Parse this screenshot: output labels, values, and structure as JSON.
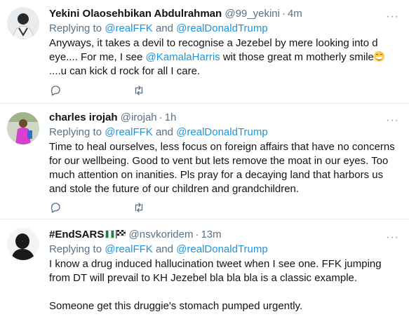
{
  "tweets": [
    {
      "name": "Yekini Olaosehbikan Abdulrahman",
      "handle": "@99_yekini",
      "time": "4m",
      "replying_prefix": "Replying to",
      "reply_user1": "@realFFK",
      "reply_and": "and",
      "reply_user2": "@realDonaldTrump",
      "text_part1": "Anyways, it takes a devil to recognise a Jezebel by mere looking into d eye.... For me, I see",
      "mention": "@KamalaHarris",
      "text_part2": " wit those great m motherly smile",
      "emoji": "grinning-face-with-smiling-eyes",
      "text_part3": "....u can kick d rock for all I care."
    },
    {
      "name": "charles irojah",
      "handle": "@irojah",
      "time": "1h",
      "replying_prefix": "Replying to",
      "reply_user1": "@realFFK",
      "reply_and": "and",
      "reply_user2": "@realDonaldTrump",
      "text": "Time to heal ourselves, less focus on foreign affairs that have no concerns for our wellbeing. Good to vent but lets remove the moat in our eyes. Too much attention on inanities. Pls pray for a decaying land that harbors us and stole the future of our children and grandchildren."
    },
    {
      "name": "#EndSARS",
      "handle": "@nsvkoridem",
      "time": "13m",
      "replying_prefix": "Replying to",
      "reply_user1": "@realFFK",
      "reply_and": "and",
      "reply_user2": "@realDonaldTrump",
      "text_line1": "I know a drug induced hallucination tweet when I see one. FFK jumping from DT will prevail to KH Jezebel bla bla bla is a classic example.",
      "text_line2": "Someone get this druggie's stomach pumped urgently."
    }
  ],
  "colors": {
    "link": "#1b95e0",
    "secondary_text": "#5b7083",
    "primary_text": "#0f1419",
    "divider": "#e6ecf0"
  }
}
